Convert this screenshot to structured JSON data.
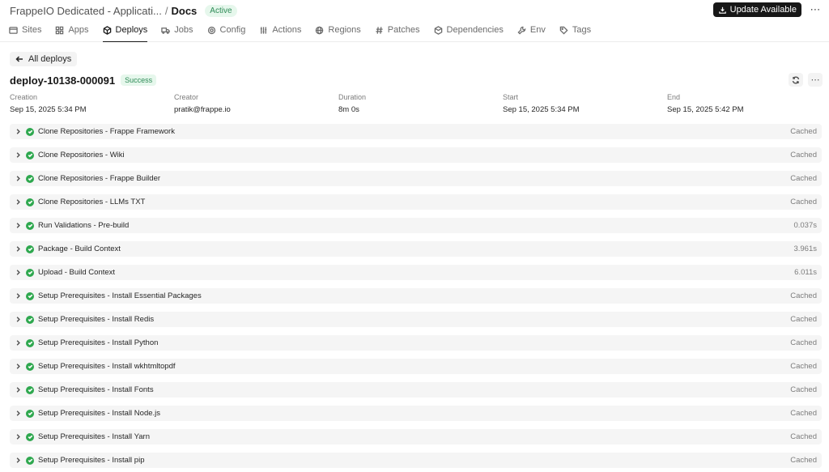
{
  "header": {
    "parent": "FrappeIO Dedicated - Applicati...",
    "separator": "/",
    "current": "Docs",
    "status": "Active",
    "update_label": "Update Available",
    "more_icon": "more-horizontal-icon"
  },
  "tabs": [
    {
      "label": "Sites",
      "icon": "window-icon"
    },
    {
      "label": "Apps",
      "icon": "grid-icon"
    },
    {
      "label": "Deploys",
      "icon": "package-icon",
      "active": true
    },
    {
      "label": "Jobs",
      "icon": "truck-icon"
    },
    {
      "label": "Config",
      "icon": "gear-icon"
    },
    {
      "label": "Actions",
      "icon": "sliders-icon"
    },
    {
      "label": "Regions",
      "icon": "globe-icon"
    },
    {
      "label": "Patches",
      "icon": "hash-icon"
    },
    {
      "label": "Dependencies",
      "icon": "box-icon"
    },
    {
      "label": "Env",
      "icon": "wrench-icon"
    },
    {
      "label": "Tags",
      "icon": "tag-icon"
    }
  ],
  "back": {
    "label": "All deploys"
  },
  "deploy": {
    "name": "deploy-10138-000091",
    "status": "Success"
  },
  "meta": {
    "creation_label": "Creation",
    "creation": "Sep 15, 2025 5:34 PM",
    "creator_label": "Creator",
    "creator": "pratik@frappe.io",
    "duration_label": "Duration",
    "duration": "8m 0s",
    "start_label": "Start",
    "start": "Sep 15, 2025 5:34 PM",
    "end_label": "End",
    "end": "Sep 15, 2025 5:42 PM"
  },
  "steps": [
    {
      "title": "Clone Repositories - Frappe Framework",
      "status": "Cached"
    },
    {
      "title": "Clone Repositories - Wiki",
      "status": "Cached"
    },
    {
      "title": "Clone Repositories - Frappe Builder",
      "status": "Cached"
    },
    {
      "title": "Clone Repositories - LLMs TXT",
      "status": "Cached"
    },
    {
      "title": "Run Validations - Pre-build",
      "status": "0.037s"
    },
    {
      "title": "Package - Build Context",
      "status": "3.961s"
    },
    {
      "title": "Upload - Build Context",
      "status": "6.011s"
    },
    {
      "title": "Setup Prerequisites - Install Essential Packages",
      "status": "Cached"
    },
    {
      "title": "Setup Prerequisites - Install Redis",
      "status": "Cached"
    },
    {
      "title": "Setup Prerequisites - Install Python",
      "status": "Cached"
    },
    {
      "title": "Setup Prerequisites - Install wkhtmltopdf",
      "status": "Cached"
    },
    {
      "title": "Setup Prerequisites - Install Fonts",
      "status": "Cached"
    },
    {
      "title": "Setup Prerequisites - Install Node.js",
      "status": "Cached"
    },
    {
      "title": "Setup Prerequisites - Install Yarn",
      "status": "Cached"
    },
    {
      "title": "Setup Prerequisites - Install pip",
      "status": "Cached"
    }
  ],
  "colors": {
    "success": "#2fa84f",
    "badge_bg": "#e6f7ec",
    "badge_text": "#2e8b57",
    "dark_button": "#171717"
  }
}
